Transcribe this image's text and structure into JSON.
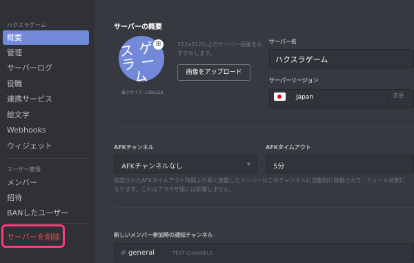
{
  "sidebar": {
    "server_header": "ハクスラゲーム",
    "items": [
      {
        "label": "概要"
      },
      {
        "label": "管理"
      },
      {
        "label": "サーバーログ"
      },
      {
        "label": "役職"
      },
      {
        "label": "連携サービス"
      },
      {
        "label": "絵文字"
      },
      {
        "label": "Webhooks"
      },
      {
        "label": "ウィジェット"
      }
    ],
    "user_header": "ユーザー管理",
    "user_items": [
      {
        "label": "メンバー"
      },
      {
        "label": "招待"
      },
      {
        "label": "BANしたユーザー"
      }
    ],
    "delete_label": "サーバーを削除"
  },
  "overview": {
    "title": "サーバーの概要",
    "icon_text": "ス ゲ\nラ ー\n  ム",
    "min_size": "最小サイズ: 128x128",
    "recommend": "512x512以上のサーバー画像をおすすめします。",
    "upload_label": "画像をアップロード",
    "server_name_label": "サーバー名",
    "server_name_value": "ハクスラゲーム",
    "region_label": "サーバーリージョン",
    "region_value": "Japan",
    "change_label": "変更"
  },
  "afk": {
    "channel_label": "AFKチャンネル",
    "channel_value": "AFKチャンネルなし",
    "timeout_label": "AFKタイムアウト",
    "timeout_value": "5分",
    "description": "指定されたAFKタイムアウト時間より長く放置したメンバーはこのチャンネルに自動的に移動されて、ミュート状態になります。これはブラウザ版には影響しません。"
  },
  "welcome": {
    "label": "新しいメンバー参加時の通知チャンネル",
    "hash": "#",
    "channel": "general",
    "channel_sub": "TEXT CHANNELS"
  },
  "colors": {
    "accent": "#7289da",
    "danger": "#f04747",
    "highlight_box": "#ff3d7b"
  }
}
